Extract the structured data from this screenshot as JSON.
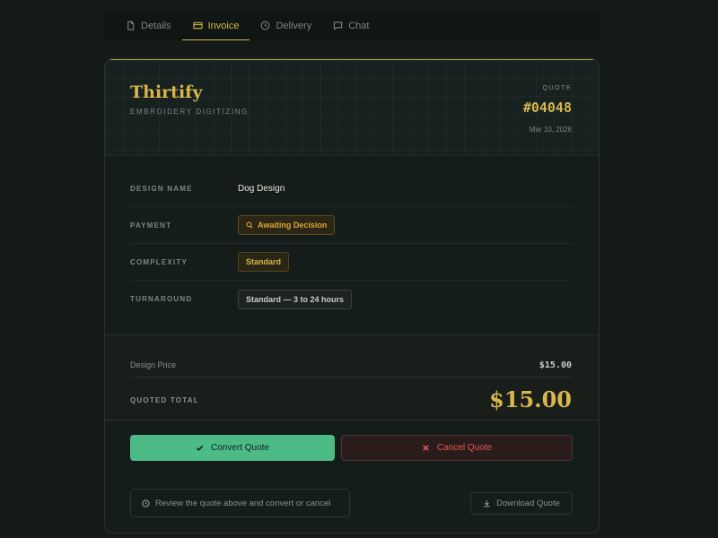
{
  "tabs": [
    {
      "label": "Details",
      "icon": "document-icon",
      "active": false
    },
    {
      "label": "Invoice",
      "icon": "credit-card-icon",
      "active": true
    },
    {
      "label": "Delivery",
      "icon": "clock-icon",
      "active": false
    },
    {
      "label": "Chat",
      "icon": "chat-bubble-icon",
      "active": false
    }
  ],
  "header": {
    "brand": "Thirtify",
    "subtitle": "EMBROIDERY DIGITIZING",
    "quote_label": "QUOTE",
    "quote_number": "#04048",
    "date": "Mar 10, 2026"
  },
  "details": {
    "design_name_label": "DESIGN NAME",
    "design_name": "Dog Design",
    "payment_label": "PAYMENT",
    "payment_status": "Awaiting Decision",
    "complexity_label": "COMPLEXITY",
    "complexity": "Standard",
    "turnaround_label": "TURNAROUND",
    "turnaround": "Standard — 3 to 24 hours"
  },
  "totals": {
    "price_label": "Design Price",
    "price_value": "$15.00",
    "total_label": "QUOTED TOTAL",
    "total_value": "$15.00"
  },
  "actions": {
    "convert_label": "Convert Quote",
    "cancel_label": "Cancel Quote",
    "hint": "Review the quote above and convert or cancel",
    "download_label": "Download Quote"
  },
  "colors": {
    "accent_gold": "#d9b64c",
    "success_green": "#4dbb85",
    "danger_red": "#e05a55",
    "warning_amber": "#e0a538"
  }
}
